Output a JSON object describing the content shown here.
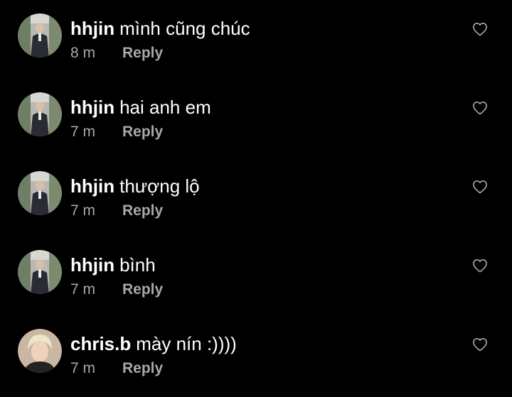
{
  "comments": [
    {
      "username": "hhjin",
      "text": "mình cũng chúc",
      "time": "8 m",
      "reply_label": "Reply",
      "avatar": "avatar-hhjin",
      "like_icon": "heart-outline-icon"
    },
    {
      "username": "hhjin",
      "text": "hai anh em",
      "time": "7 m",
      "reply_label": "Reply",
      "avatar": "avatar-hhjin",
      "like_icon": "heart-outline-icon"
    },
    {
      "username": "hhjin",
      "text": "thượng lộ",
      "time": "7 m",
      "reply_label": "Reply",
      "avatar": "avatar-hhjin",
      "like_icon": "heart-outline-icon"
    },
    {
      "username": "hhjin",
      "text": "bình",
      "time": "7 m",
      "reply_label": "Reply",
      "avatar": "avatar-hhjin",
      "like_icon": "heart-outline-icon"
    },
    {
      "username": "chris.b",
      "text": "mày nín :))))",
      "time": "7 m",
      "reply_label": "Reply",
      "avatar": "avatar-chris-b",
      "like_icon": "heart-outline-icon"
    }
  ],
  "colors": {
    "background": "#000000",
    "primary_text": "#ffffff",
    "secondary_text": "#a8a8a8"
  }
}
